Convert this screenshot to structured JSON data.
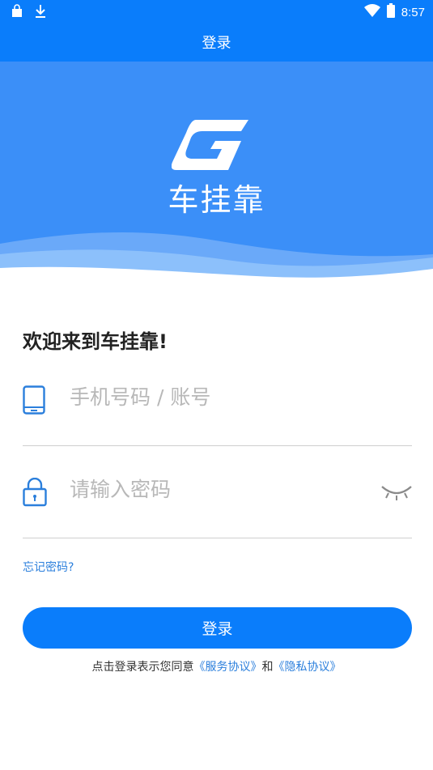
{
  "status_bar": {
    "time": "8:57",
    "icons": [
      "shopping-bag-icon",
      "download-icon",
      "wifi-icon",
      "battery-icon"
    ]
  },
  "navbar": {
    "title": "登录"
  },
  "hero": {
    "brand_name": "车挂靠",
    "logo_icon": "brand-logo-g-icon",
    "colors": {
      "hero_bg": "#3b8ff8",
      "wave_light": "#8cc0fb",
      "nav_bg": "#0a7dfb"
    }
  },
  "form": {
    "welcome": "欢迎来到车挂靠!",
    "phone": {
      "placeholder": "手机号码 / 账号",
      "value": "",
      "icon": "phone-icon"
    },
    "password": {
      "placeholder": "请输入密码",
      "value": "",
      "icon": "lock-icon",
      "toggle_icon": "eye-closed-icon"
    },
    "forgot_password": "忘记密码?",
    "login_button": "登录"
  },
  "agreement": {
    "prefix": "点击登录表示您同意",
    "service_link": "《服务协议》",
    "conjunction": "和",
    "privacy_link": "《隐私协议》"
  },
  "colors": {
    "accent": "#0a7dfb",
    "link": "#2b7fdc",
    "divider": "#cfcfcf",
    "placeholder": "#b8b8b8"
  }
}
